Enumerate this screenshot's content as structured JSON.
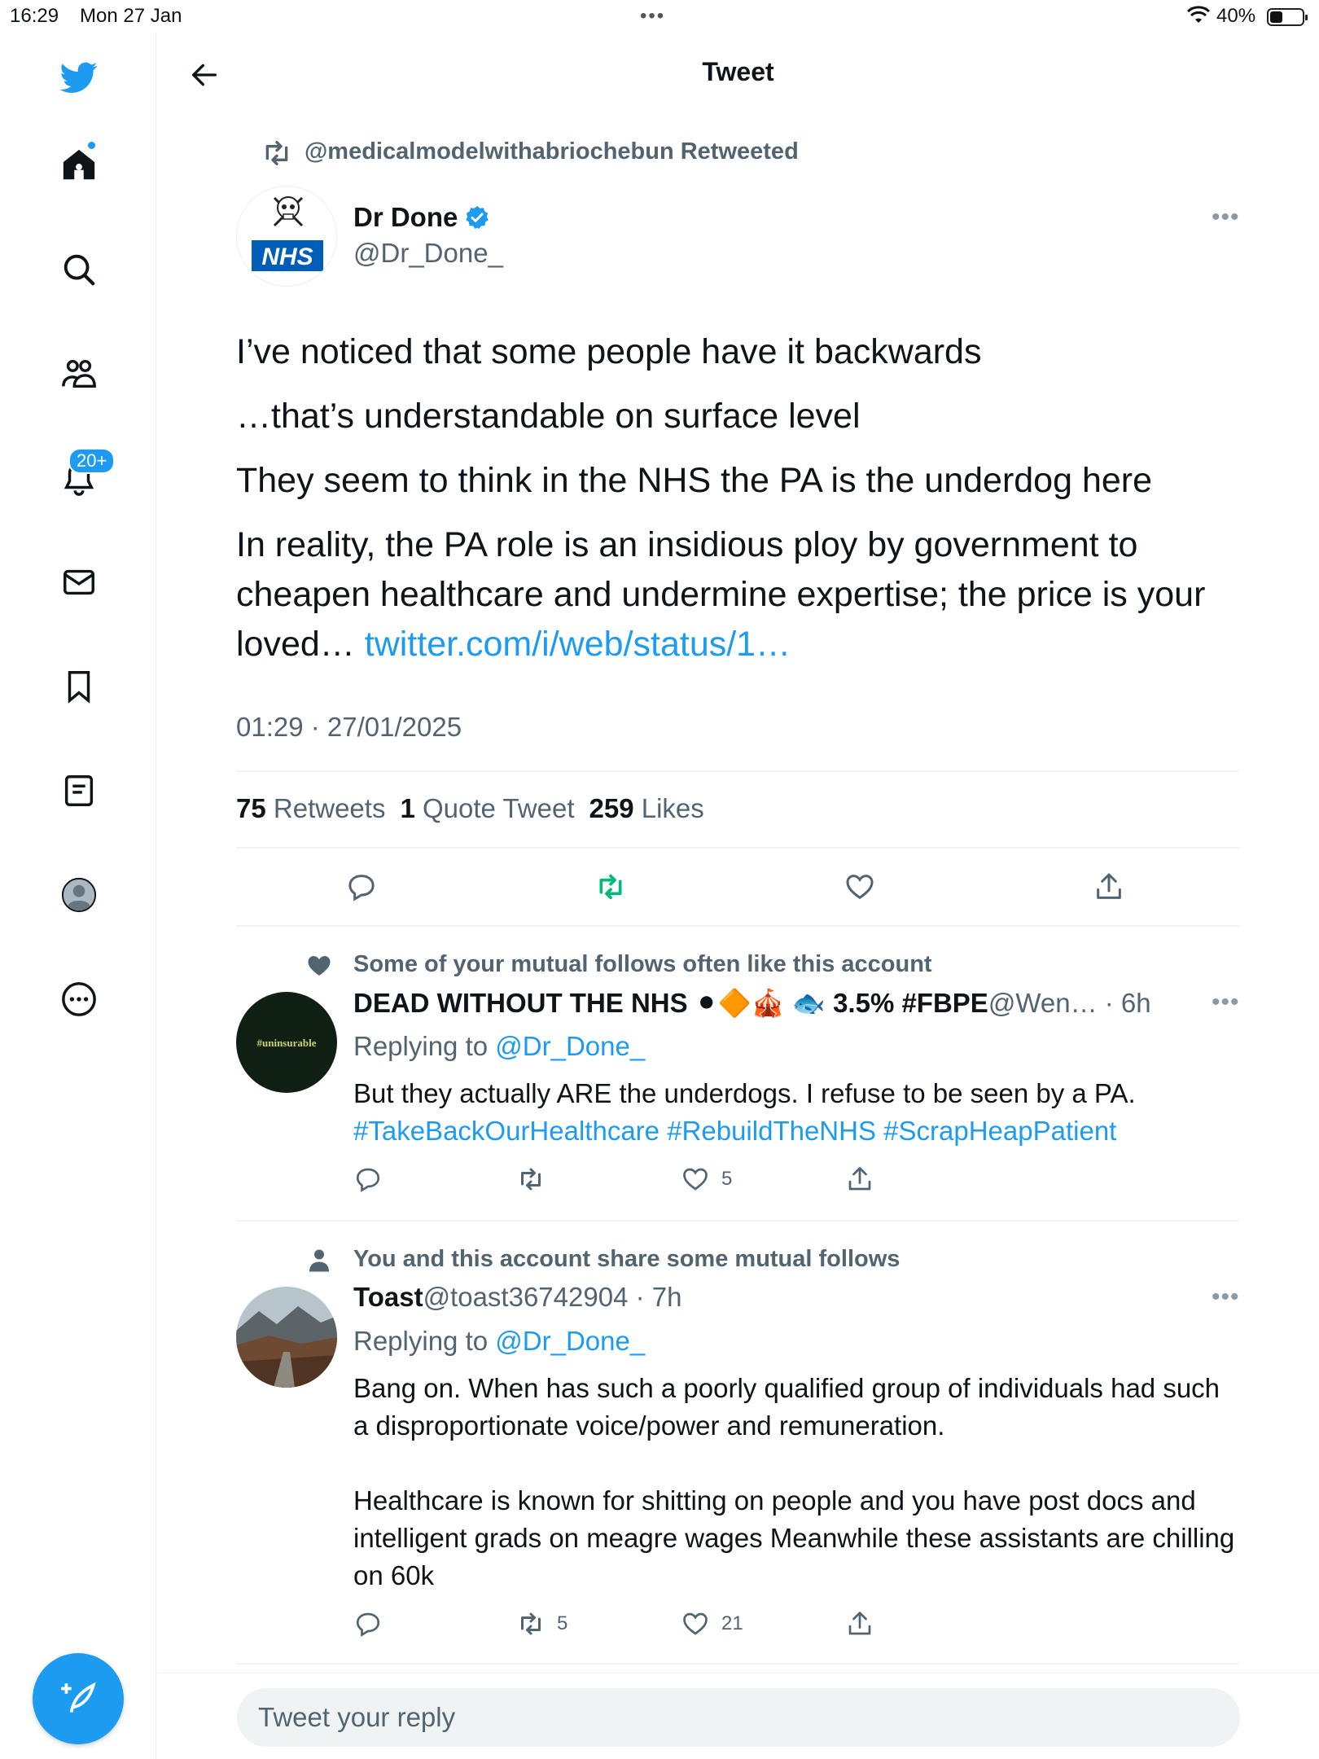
{
  "status_bar": {
    "time": "16:29",
    "date": "Mon 27 Jan",
    "battery": "40%",
    "battery_fraction": 0.4
  },
  "header": {
    "title": "Tweet"
  },
  "sidebar": {
    "notifications_badge": "20+"
  },
  "tweet": {
    "retweeted_by": "@medicalmodelwithabriochebun Retweeted",
    "author_name": "Dr Done",
    "author_handle": "@Dr_Done_",
    "avatar_text": "NHS",
    "lines": [
      "I’ve noticed that some people have it backwards",
      "…that’s understandable on surface level",
      "They seem to think in the NHS the PA is the underdog here",
      "In reality, the PA role is an insidious ploy by government to cheapen healthcare and undermine expertise; the price is your loved…"
    ],
    "link": "twitter.com/i/web/status/1…",
    "timestamp": "01:29 · 27/01/2025",
    "retweets_count": "75",
    "retweets_label": "Retweets",
    "quote_count": "1",
    "quote_label": "Quote Tweet",
    "likes_count": "259",
    "likes_label": "Likes"
  },
  "replies": [
    {
      "context": "Some of your mutual follows often like this account",
      "name": "DEAD WITHOUT THE NHS ⚫🔶🎪 🐟 3.5% #FBPE",
      "handle_time": " @Wen… · 6h",
      "avatar_text": "#uninsurable",
      "replying_prefix": "Replying to ",
      "replying_to": "@Dr_Done_",
      "text": "But they actually ARE the underdogs. I refuse to be seen by a PA.",
      "hashtags": "#TakeBackOurHealthcare #RebuildTheNHS #ScrapHeapPatient",
      "retweets": "",
      "likes": "5"
    },
    {
      "context": "You and this account share some mutual follows",
      "name": "Toast",
      "handle_time": " @toast36742904 · 7h",
      "replying_prefix": "Replying to ",
      "replying_to": "@Dr_Done_",
      "text1": "Bang on. When has such a poorly qualified group of individuals had such a disproportionate voice/power and remuneration.",
      "text2": "Healthcare is known for shitting on people and you have post docs and intelligent grads on meagre wages Meanwhile these assistants are chilling on 60k",
      "retweets": "5",
      "likes": "21"
    }
  ],
  "reply_box": {
    "placeholder": "Tweet your reply"
  },
  "colors": {
    "accent": "#1d9bf0",
    "retweet_active": "#00ba7c",
    "muted": "#536471"
  }
}
